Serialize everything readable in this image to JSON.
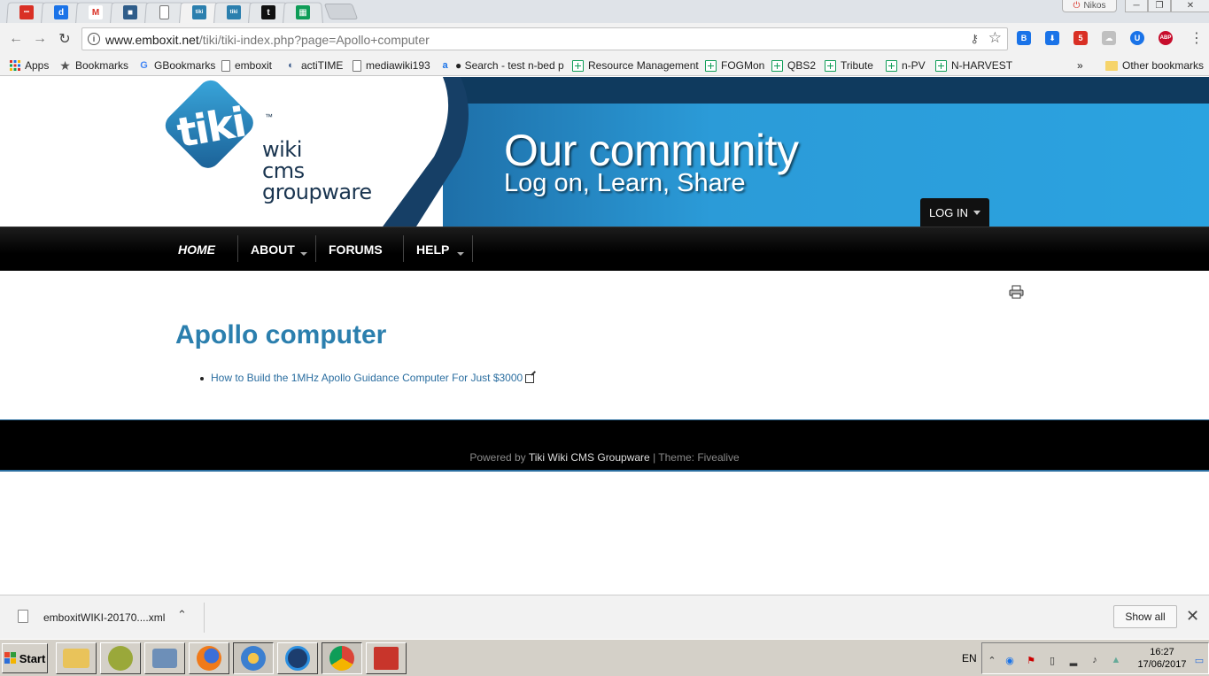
{
  "browser": {
    "tabs": [
      {
        "icon": "red-dots-icon",
        "color": "#d93025",
        "glyph": "•••"
      },
      {
        "icon": "d-app-icon",
        "color": "#1a73e8",
        "glyph": "d"
      },
      {
        "icon": "gmail-icon",
        "color": "#ffffff",
        "glyph": "M"
      },
      {
        "icon": "shield-tab-icon",
        "color": "#2f5d8a",
        "glyph": "■"
      },
      {
        "icon": "page-icon",
        "color": "#ffffff",
        "glyph": ""
      },
      {
        "icon": "tiki-icon",
        "color": "#2b7fae",
        "glyph": "tiki"
      },
      {
        "icon": "tiki-icon",
        "color": "#2b7fae",
        "glyph": "tiki"
      },
      {
        "icon": "toggl-icon",
        "color": "#111111",
        "glyph": "t"
      },
      {
        "icon": "sheets-icon",
        "color": "#0f9d58",
        "glyph": "▦"
      }
    ],
    "profile_name": "Nikos",
    "url_host": "www.emboxit.net",
    "url_path": "/tiki/tiki-index.php?page=Apollo+computer",
    "extensions": [
      {
        "icon": "b-extension-icon",
        "color": "#1a73e8",
        "glyph": "B"
      },
      {
        "icon": "download-arrow-extension-icon",
        "color": "#1a73e8",
        "glyph": "⬇"
      },
      {
        "icon": "red-badge-extension-icon",
        "color": "#d93025",
        "glyph": "5"
      },
      {
        "icon": "cloud-extension-icon",
        "color": "#c0c0c0",
        "glyph": "☁"
      },
      {
        "icon": "pocket-extension-icon",
        "color": "#1a73e8",
        "glyph": "U"
      },
      {
        "icon": "adblock-plus-icon",
        "color": "#c70d2c",
        "glyph": "ABP"
      }
    ],
    "bookmarks": [
      {
        "label": "Apps",
        "icon": "apps-grid-icon"
      },
      {
        "label": "Bookmarks",
        "icon": "star-icon"
      },
      {
        "label": "GBookmarks",
        "icon": "google-icon"
      },
      {
        "label": "emboxit",
        "icon": "page-icon"
      },
      {
        "label": "actiTIME",
        "icon": "actitime-icon"
      },
      {
        "label": "mediawiki193",
        "icon": "page-icon"
      },
      {
        "label": "● Search - test n-bed p",
        "icon": "search-site-icon"
      },
      {
        "label": "Resource Management",
        "icon": "sheets-icon"
      },
      {
        "label": "FOGMon",
        "icon": "sheets-icon"
      },
      {
        "label": "QBS2",
        "icon": "sheets-icon"
      },
      {
        "label": "Tribute",
        "icon": "sheets-icon"
      },
      {
        "label": "n-PV",
        "icon": "sheets-icon"
      },
      {
        "label": "N-HARVEST",
        "icon": "sheets-icon"
      }
    ],
    "overflow": "»",
    "other_bookmarks": "Other bookmarks"
  },
  "site": {
    "logo_mark": "tiki",
    "logo_tm": "™",
    "logo_words": [
      "wiki",
      "cms",
      "groupware"
    ],
    "banner_title": "Our community",
    "banner_subtitle": "Log on, Learn, Share",
    "login_label": "LOG IN",
    "nav": [
      {
        "label": "HOME"
      },
      {
        "label": "ABOUT"
      },
      {
        "label": "FORUMS"
      },
      {
        "label": "HELP"
      }
    ],
    "colors": {
      "title": "#2b7fae",
      "banner_blue": "#2b9bd8",
      "banner_dark": "#0f3a5e"
    }
  },
  "content": {
    "page_title": "Apollo computer",
    "links": [
      {
        "text": "How to Build the 1MHz Apollo Guidance Computer For Just $3000"
      }
    ]
  },
  "footer": {
    "powered_by": "Powered by",
    "product": "Tiki Wiki CMS Groupware",
    "theme": "| Theme: Fivealive"
  },
  "downloads": {
    "filename": "emboxitWIKI-20170....xml",
    "show_all": "Show all"
  },
  "taskbar": {
    "start_label": "Start",
    "language": "EN",
    "time": "16:27",
    "date": "17/06/2017"
  }
}
